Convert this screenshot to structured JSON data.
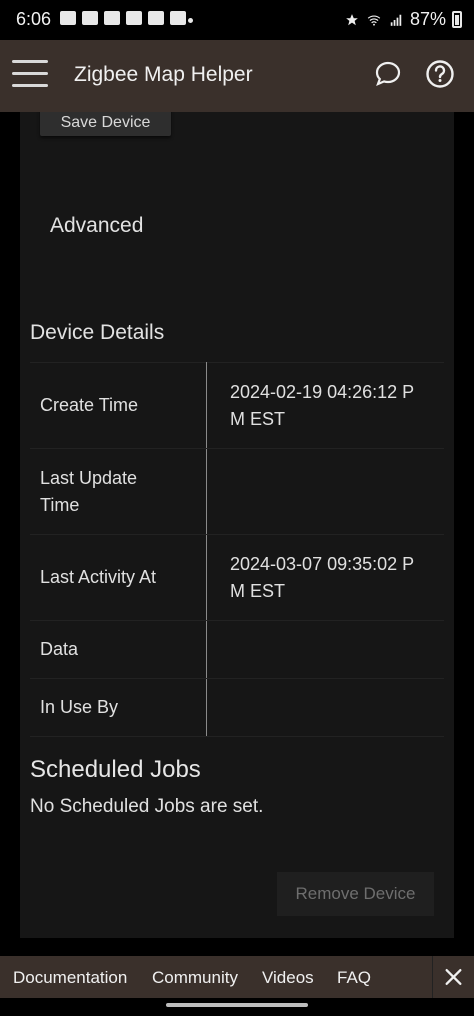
{
  "status_bar": {
    "time": "6:06",
    "battery_percent": "87%",
    "left_icons": [
      "mail-icon",
      "home-icon",
      "outlook-icon",
      "outlook-icon",
      "app-icon",
      "gallery-icon"
    ],
    "right_icons": [
      "star-icon",
      "wifi-icon",
      "signal-icon",
      "battery-icon"
    ]
  },
  "app_bar": {
    "title": "Zigbee Map Helper",
    "icons": [
      "menu-icon",
      "chat-icon",
      "help-icon"
    ]
  },
  "main": {
    "save_button_label": "Save Device",
    "advanced_label": "Advanced",
    "device_details_title": "Device Details",
    "details": [
      {
        "label": "Create Time",
        "value": "2024-02-19 04:26:12 P\nM EST"
      },
      {
        "label": "Last Update\nTime",
        "value": ""
      },
      {
        "label": "Last Activity At",
        "value": "2024-03-07 09:35:02 P\nM EST"
      },
      {
        "label": "Data",
        "value": ""
      },
      {
        "label": "In Use By",
        "value": ""
      }
    ],
    "scheduled_jobs_title": "Scheduled Jobs",
    "scheduled_jobs_empty": "No Scheduled Jobs are set.",
    "remove_button_label": "Remove Device"
  },
  "footer": {
    "links": [
      "Documentation",
      "Community",
      "Videos",
      "FAQ"
    ],
    "close_icon": "close-icon"
  },
  "colors": {
    "app_bar_bg": "#3a302b",
    "card_bg": "#161616",
    "page_bg": "#000000"
  }
}
